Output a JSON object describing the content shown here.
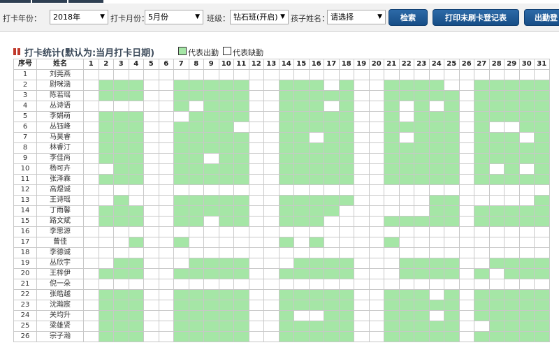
{
  "filters": {
    "year_label": "打卡年份：",
    "year_value": "2018年",
    "month_label": "打卡月份：",
    "month_value": "5月份",
    "class_label": "班级：",
    "class_value": "钻石班(开启)",
    "child_label": "孩子姓名：",
    "child_value": "请选择"
  },
  "buttons": {
    "search": "检索",
    "print": "打印未刷卡登记表",
    "attendance": "出勤登"
  },
  "section": {
    "title": "打卡统计(默认为:当月打卡日期)",
    "legend_present": "代表出勤",
    "legend_absent": "代表缺勤"
  },
  "colors": {
    "present": "#a5e6a6",
    "absent": "#ffffff",
    "button": "#1f5c9c",
    "title_icon": "#c0392b"
  },
  "table": {
    "col_index": "序号",
    "col_name": "姓名",
    "days": [
      "1",
      "2",
      "3",
      "4",
      "5",
      "6",
      "7",
      "8",
      "9",
      "10",
      "11",
      "12",
      "13",
      "14",
      "15",
      "16",
      "17",
      "18",
      "19",
      "20",
      "21",
      "22",
      "23",
      "24",
      "25",
      "26",
      "27",
      "28",
      "29",
      "30",
      "31"
    ],
    "rows": [
      {
        "no": "1",
        "name": "刘莞燕",
        "att": "0000000000000000000000000000000"
      },
      {
        "no": "2",
        "name": "尉咪涵",
        "att": "0111001111100111010011110011111"
      },
      {
        "no": "3",
        "name": "陈若瑶",
        "att": "0111001111100111110011111011111"
      },
      {
        "no": "4",
        "name": "丛诗语",
        "att": "0000001011100111010010101011111"
      },
      {
        "no": "5",
        "name": "李娟萌",
        "att": "0111000111100111110010111011111"
      },
      {
        "no": "6",
        "name": "丛钰峰",
        "att": "0111001111000111110011111010011"
      },
      {
        "no": "7",
        "name": "马昊睿",
        "att": "0111001111100110110010111011101"
      },
      {
        "no": "8",
        "name": "林睿汀",
        "att": "0111001111100111110011111011111"
      },
      {
        "no": "9",
        "name": "李佳尚",
        "att": "0111001101100111110011111011111"
      },
      {
        "no": "10",
        "name": "杨可卉",
        "att": "0011001111100111110011111010101"
      },
      {
        "no": "11",
        "name": "张泽霖",
        "att": "0111001111100111110011111011111"
      },
      {
        "no": "12",
        "name": "高煜诚",
        "att": "0000000000000000000000000000000"
      },
      {
        "no": "13",
        "name": "王诗瑶",
        "att": "0010001111100111110000011000001"
      },
      {
        "no": "14",
        "name": "丁雨馨",
        "att": "0111001111100111100000011011111"
      },
      {
        "no": "15",
        "name": "路文斌",
        "att": "0111001101100111000011111011111"
      },
      {
        "no": "16",
        "name": "李思源",
        "att": "0000000000000000000000000000000"
      },
      {
        "no": "17",
        "name": "曾佳",
        "att": "0001001000000101000010000000000"
      },
      {
        "no": "18",
        "name": "李德诚",
        "att": "0000000000000000000000000000000"
      },
      {
        "no": "19",
        "name": "丛欣宇",
        "att": "0011000111100011110001111001111"
      },
      {
        "no": "20",
        "name": "王梓伊",
        "att": "0111001111100111110001111010111"
      },
      {
        "no": "21",
        "name": "倪一朵",
        "att": "0000000000000000000000000000000"
      },
      {
        "no": "22",
        "name": "张皓越",
        "att": "0111001111100111110011101011111"
      },
      {
        "no": "23",
        "name": "沈瀚宸",
        "att": "0111001111100111110011111011111"
      },
      {
        "no": "24",
        "name": "关均升",
        "att": "0111001111100100110011101011111"
      },
      {
        "no": "25",
        "name": "梁雄贤",
        "att": "0111001111100111110011111001111"
      },
      {
        "no": "26",
        "name": "宗子瀚",
        "att": "0111001111100111110011111011111"
      }
    ]
  }
}
